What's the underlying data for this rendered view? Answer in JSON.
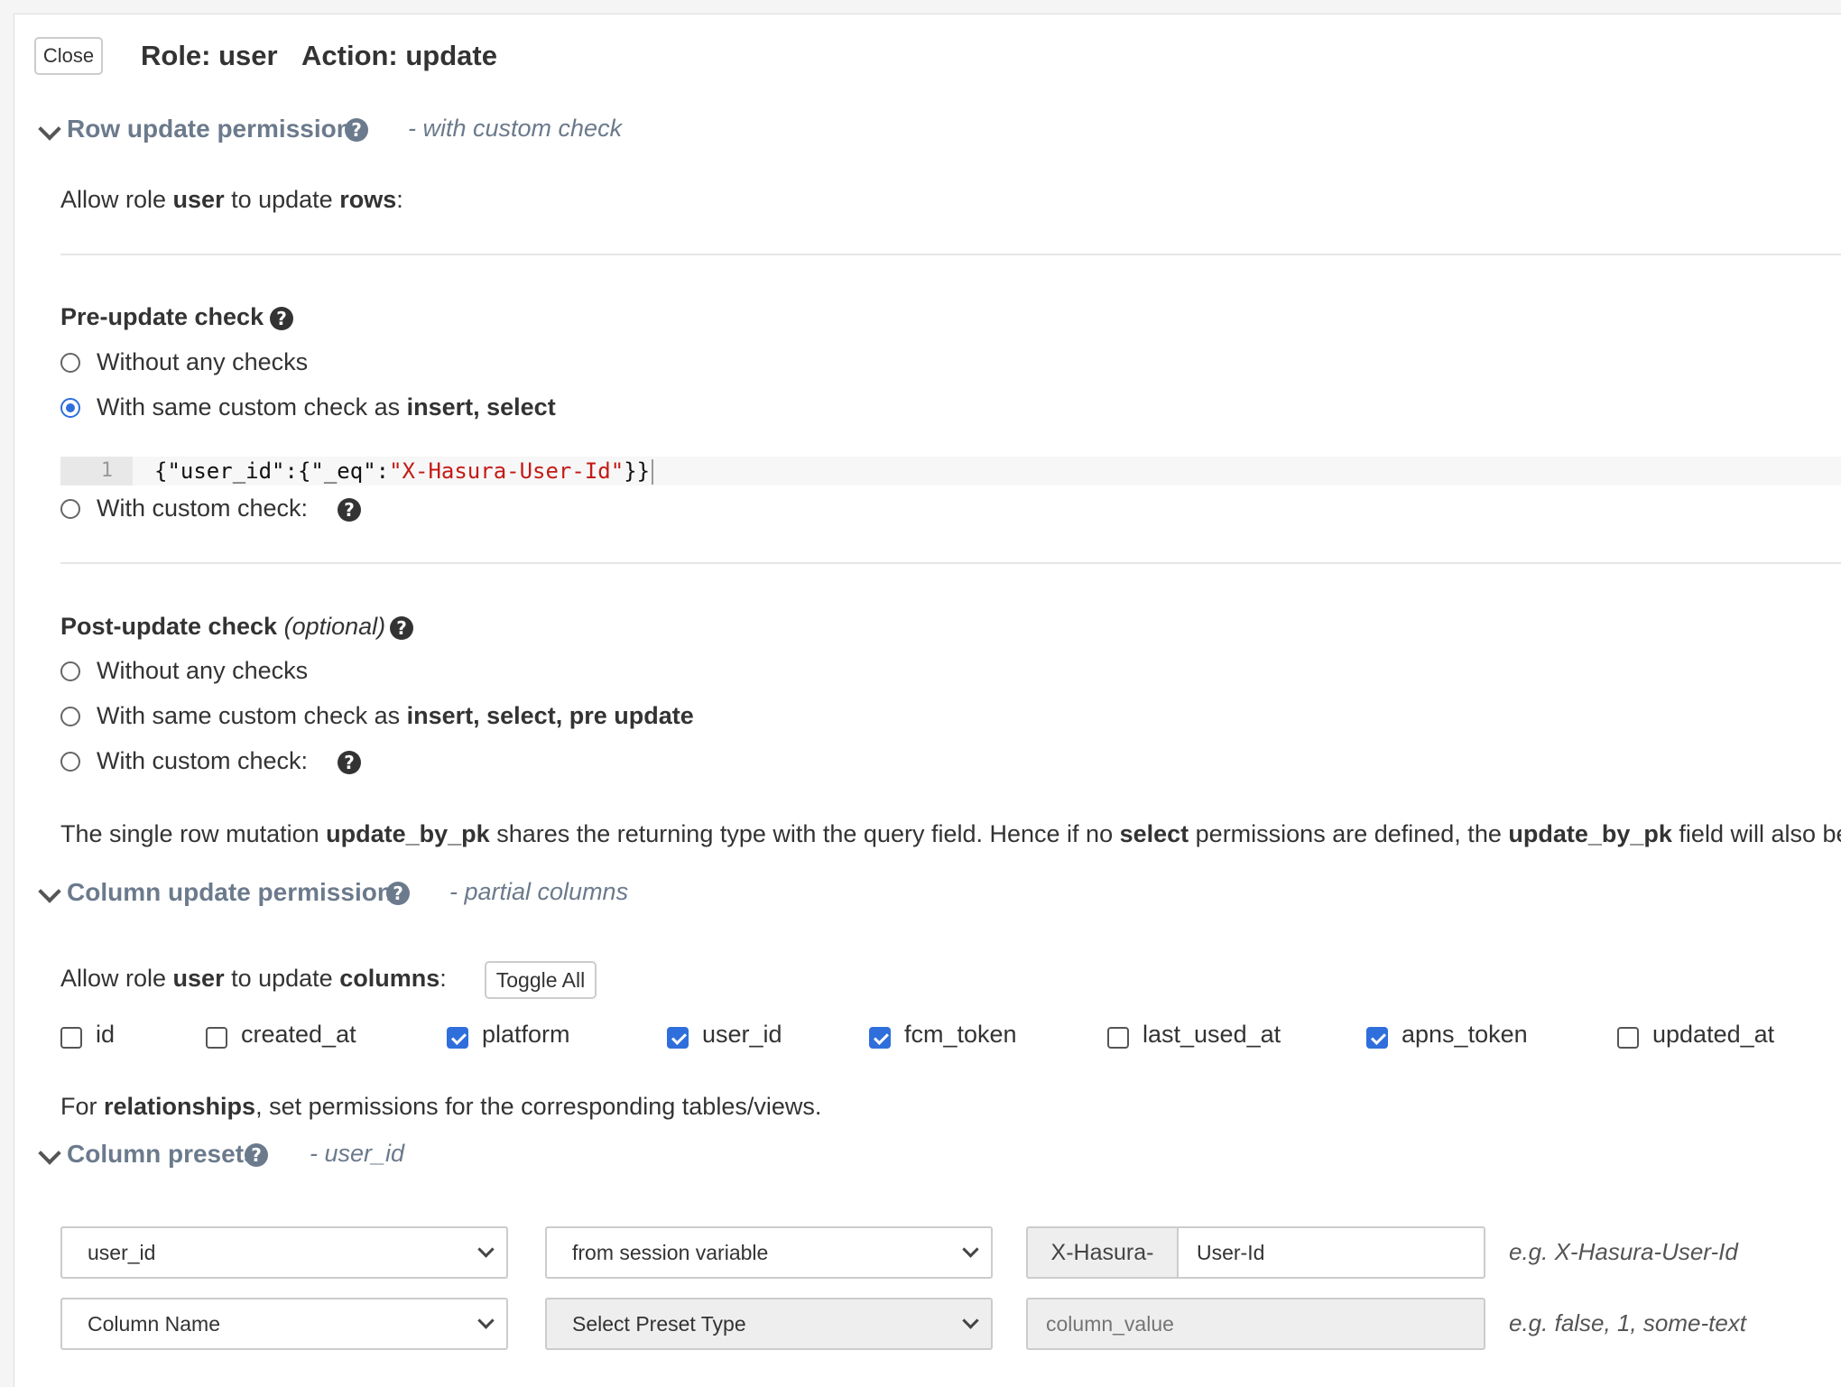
{
  "header": {
    "close_label": "Close",
    "role": "Role: user",
    "action": "Action: update"
  },
  "row_section": {
    "title": "Row update permissions",
    "subtitle": "- with custom check",
    "allow_pre": "Allow role ",
    "allow_role": "user",
    "allow_mid": " to update ",
    "allow_target": "rows",
    "allow_post": ":"
  },
  "pre_update": {
    "heading": "Pre-update check",
    "options": [
      {
        "label": "Without any checks",
        "bold": "",
        "selected": false
      },
      {
        "label": "With same custom check as ",
        "bold": "insert, select",
        "selected": true
      },
      {
        "label": "With custom check:",
        "bold": "",
        "selected": false
      }
    ],
    "code_line_number": "1",
    "code_prefix": "{\"user_id\":{\"_eq\":",
    "code_string": "\"X-Hasura-User-Id\"",
    "code_suffix": "}}"
  },
  "post_update": {
    "heading": "Post-update check",
    "heading_optional": "(optional)",
    "options": [
      {
        "label": "Without any checks",
        "bold": "",
        "selected": false
      },
      {
        "label": "With same custom check as ",
        "bold": "insert, select, pre update",
        "selected": false
      },
      {
        "label": "With custom check:",
        "bold": "",
        "selected": false
      }
    ]
  },
  "notice": {
    "t1": "The single row mutation ",
    "b1": "update_by_pk",
    "t2": " shares the returning type with the query field. Hence if no ",
    "b2": "select",
    "t3": " permissions are defined, the ",
    "b3": "update_by_pk",
    "t4": " field will also be on"
  },
  "column_section": {
    "title": "Column update permissions",
    "subtitle": "- partial columns",
    "allow_pre": "Allow role ",
    "allow_role": "user",
    "allow_mid": " to update ",
    "allow_target": "columns",
    "allow_post": ":",
    "toggle_all_label": "Toggle All",
    "columns": [
      {
        "name": "id",
        "checked": false
      },
      {
        "name": "created_at",
        "checked": false
      },
      {
        "name": "platform",
        "checked": true
      },
      {
        "name": "user_id",
        "checked": true
      },
      {
        "name": "fcm_token",
        "checked": true
      },
      {
        "name": "last_used_at",
        "checked": false
      },
      {
        "name": "apns_token",
        "checked": true
      },
      {
        "name": "updated_at",
        "checked": false
      }
    ],
    "rel_pre": "For ",
    "rel_bold": "relationships",
    "rel_post": ", set permissions for the corresponding tables/views."
  },
  "presets_section": {
    "title": "Column presets",
    "subtitle": "- user_id",
    "row1": {
      "column": "user_id",
      "type": "from session variable",
      "prefix": "X-Hasura-",
      "value": "User-Id",
      "hint": "e.g. X-Hasura-User-Id"
    },
    "row2": {
      "column": "Column Name",
      "type": "Select Preset Type",
      "placeholder": "column_value",
      "hint": "e.g. false, 1, some-text"
    }
  },
  "colors": {
    "accent": "#2f6fdc",
    "section_title": "#6b7a8c",
    "code_string": "#c41a16"
  }
}
